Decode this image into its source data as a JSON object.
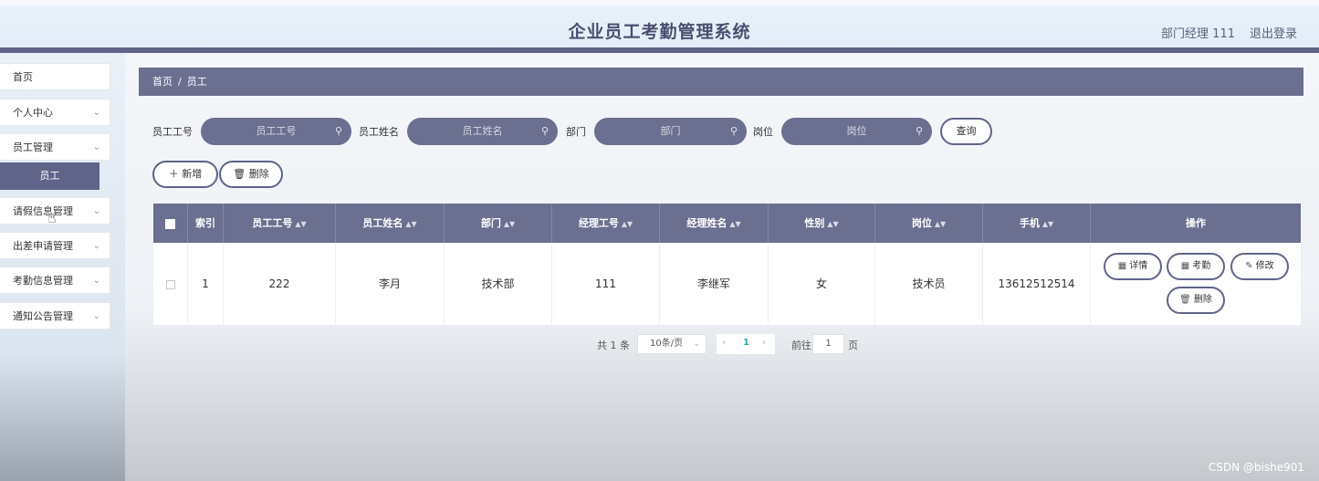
{
  "header": {
    "title": "企业员工考勤管理系统",
    "user": "部门经理 111",
    "logout": "退出登录"
  },
  "sidebar": {
    "items": [
      {
        "label": "首页"
      },
      {
        "label": "个人中心"
      },
      {
        "label": "员工管理"
      },
      {
        "label": "请假信息管理"
      },
      {
        "label": "出差申请管理"
      },
      {
        "label": "考勤信息管理"
      },
      {
        "label": "通知公告管理"
      }
    ],
    "active_sub": "员工"
  },
  "breadcrumb": {
    "home": "首页",
    "sep": "/",
    "current": "员工"
  },
  "search": {
    "fields": [
      {
        "label": "员工工号",
        "placeholder": "员工工号"
      },
      {
        "label": "员工姓名",
        "placeholder": "员工姓名"
      },
      {
        "label": "部门",
        "placeholder": "部门"
      },
      {
        "label": "岗位",
        "placeholder": "岗位"
      }
    ],
    "query_label": "查询"
  },
  "actions": {
    "add_label": "新增",
    "delete_label": "删除"
  },
  "table": {
    "headers": [
      "索引",
      "员工工号",
      "员工姓名",
      "部门",
      "经理工号",
      "经理姓名",
      "性别",
      "岗位",
      "手机",
      "操作"
    ],
    "rows": [
      [
        "1",
        "222",
        "李月",
        "技术部",
        "111",
        "李继军",
        "女",
        "技术员",
        "13612512514"
      ]
    ],
    "row_ops": {
      "detail": "详情",
      "attendance": "考勤",
      "edit": "修改",
      "delete": "删除"
    }
  },
  "pagination": {
    "total": "共 1 条",
    "page_size": "10条/页",
    "current_page": "1",
    "goto_prefix": "前往",
    "goto_value": "1",
    "goto_suffix": "页"
  },
  "watermark": "CSDN @bishe901",
  "colors": {
    "primary": "#6b6f90",
    "header_bar": "#5f6488",
    "page_active": "#2aa8a8"
  },
  "icons": [
    "search-icon",
    "plus-icon",
    "trash-icon",
    "chevron-down-icon",
    "detail-icon",
    "edit-icon",
    "cursor-hand-icon"
  ]
}
